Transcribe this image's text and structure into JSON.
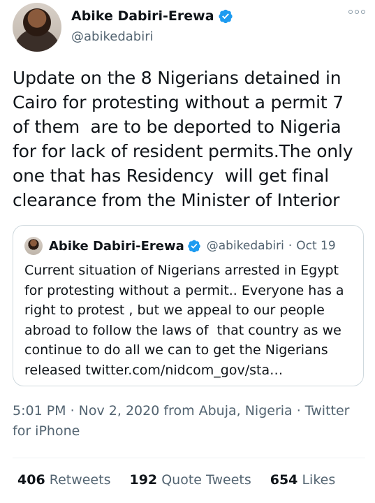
{
  "author": {
    "display_name": "Abike Dabiri-Erewa",
    "handle": "@abikedabiri"
  },
  "tweet": {
    "text": "Update on the 8 Nigerians detained in Cairo for protesting without a permit 7 of them  are to be deported to Nigeria for for lack of resident permits.The only one that has Residency  will get final clearance from the Minister of Interior"
  },
  "quote": {
    "display_name": "Abike Dabiri-Erewa",
    "handle": "@abikedabiri",
    "separator": "·",
    "date": "Oct 19",
    "text": "Current situation of Nigerians arrested in Egypt for protesting without a permit.. Everyone has a right to protest , but we appeal to our people abroad to follow the laws of  that country as we continue to do all we can to get the Nigerians released twitter.com/nidcom_gov/sta…"
  },
  "meta": {
    "line": "5:01 PM · Nov 2, 2020 from Abuja, Nigeria · Twitter for iPhone"
  },
  "stats": {
    "retweets_count": "406",
    "retweets_label": "Retweets",
    "quotes_count": "192",
    "quotes_label": "Quote Tweets",
    "likes_count": "654",
    "likes_label": "Likes"
  },
  "colors": {
    "verified_badge": "#1d9bf0",
    "secondary_text": "#536471"
  }
}
